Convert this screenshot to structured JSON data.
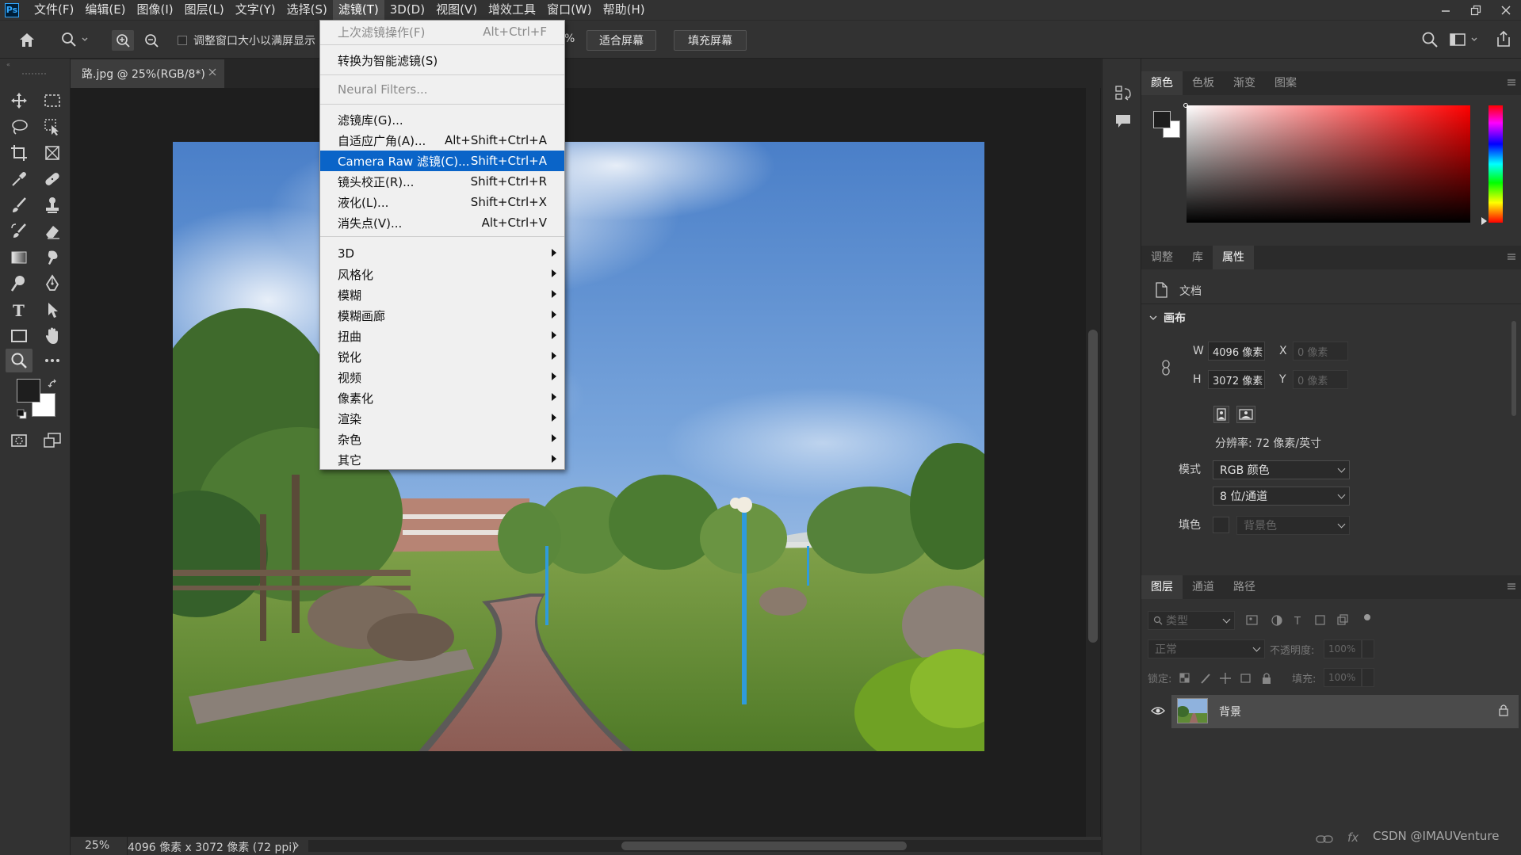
{
  "menubar": {
    "logo": "Ps",
    "items": [
      "文件(F)",
      "编辑(E)",
      "图像(I)",
      "图层(L)",
      "文字(Y)",
      "选择(S)",
      "滤镜(T)",
      "3D(D)",
      "视图(V)",
      "增效工具",
      "窗口(W)",
      "帮助(H)"
    ],
    "active_index": 6
  },
  "options": {
    "resize_checkbox_label": "调整窗口大小以满屏显示",
    "zoom_partial": "%",
    "fit_screen": "适合屏幕",
    "fill_screen": "填充屏幕"
  },
  "document": {
    "tab_title": "路.jpg @ 25%(RGB/8*)"
  },
  "status": {
    "zoom": "25%",
    "info": "4096 像素 x 3072 像素 (72 ppi)"
  },
  "filter_menu": {
    "items": [
      {
        "label": "上次滤镜操作(F)",
        "shortcut": "Alt+Ctrl+F",
        "disabled": true
      },
      {
        "label": "转换为智能滤镜(S)",
        "shortcut": ""
      },
      {
        "label": "Neural Filters...",
        "shortcut": "",
        "disabled": true
      },
      {
        "label": "滤镜库(G)...",
        "shortcut": ""
      },
      {
        "label": "自适应广角(A)...",
        "shortcut": "Alt+Shift+Ctrl+A"
      },
      {
        "label": "Camera Raw 滤镜(C)...",
        "shortcut": "Shift+Ctrl+A",
        "highlighted": true
      },
      {
        "label": "镜头校正(R)...",
        "shortcut": "Shift+Ctrl+R"
      },
      {
        "label": "液化(L)...",
        "shortcut": "Shift+Ctrl+X"
      },
      {
        "label": "消失点(V)...",
        "shortcut": "Alt+Ctrl+V"
      },
      {
        "label": "3D",
        "submenu": true
      },
      {
        "label": "风格化",
        "submenu": true
      },
      {
        "label": "模糊",
        "submenu": true
      },
      {
        "label": "模糊画廊",
        "submenu": true
      },
      {
        "label": "扭曲",
        "submenu": true
      },
      {
        "label": "锐化",
        "submenu": true
      },
      {
        "label": "视频",
        "submenu": true
      },
      {
        "label": "像素化",
        "submenu": true
      },
      {
        "label": "渲染",
        "submenu": true
      },
      {
        "label": "杂色",
        "submenu": true
      },
      {
        "label": "其它",
        "submenu": true
      }
    ]
  },
  "color_panel": {
    "tabs": [
      "颜色",
      "色板",
      "渐变",
      "图案"
    ]
  },
  "properties_panel": {
    "tabs": [
      "调整",
      "库",
      "属性"
    ],
    "doc_label": "文档",
    "section": "画布",
    "w_label": "W",
    "w_value": "4096 像素",
    "h_label": "H",
    "h_value": "3072 像素",
    "x_label": "X",
    "x_value": "0 像素",
    "y_label": "Y",
    "y_value": "0 像素",
    "resolution": "分辨率: 72 像素/英寸",
    "mode_label": "模式",
    "mode_value": "RGB 颜色",
    "depth_value": "8 位/通道",
    "fill_label": "填色",
    "fill_value": "背景色"
  },
  "layers_panel": {
    "tabs": [
      "图层",
      "通道",
      "路径"
    ],
    "filter_placeholder": "类型",
    "blend_mode": "正常",
    "opacity_label": "不透明度:",
    "opacity_value": "100%",
    "lock_label": "锁定:",
    "fill_label": "填充:",
    "fill_value": "100%",
    "layer_name": "背景"
  },
  "footer_watermark": "CSDN @IMAUVenture",
  "colors": {
    "highlight": "#0a64c8",
    "foreground": "#1e1e1e",
    "background": "#ffffff"
  }
}
